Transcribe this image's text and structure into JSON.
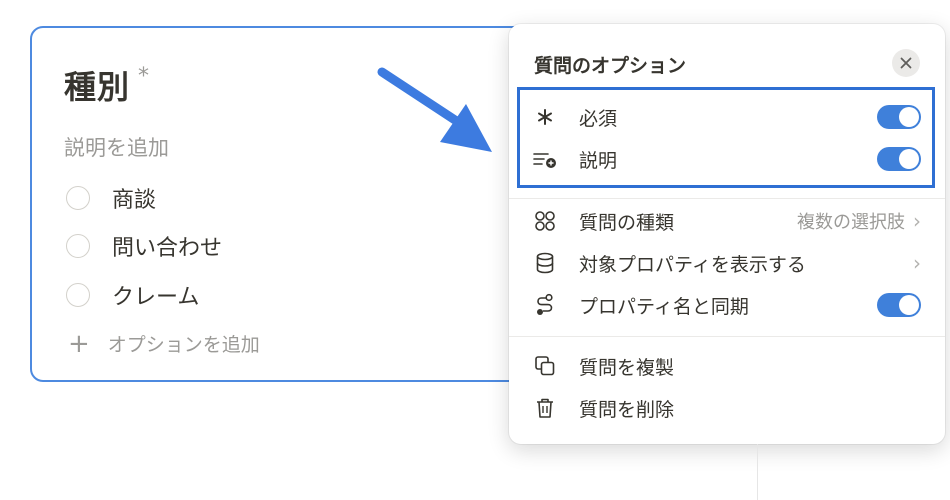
{
  "card": {
    "title": "種別",
    "required_mark": "*",
    "description_placeholder": "説明を追加",
    "options": [
      "商談",
      "問い合わせ",
      "クレーム"
    ],
    "add_option_label": "オプションを追加"
  },
  "menu": {
    "title": "質問のオプション",
    "items": {
      "required": {
        "label": "必須",
        "icon": "asterisk-icon",
        "toggle_on": true
      },
      "description": {
        "label": "説明",
        "icon": "lines-plus-icon",
        "toggle_on": true
      },
      "question_type": {
        "label": "質問の種類",
        "value": "複数の選択肢",
        "icon": "four-circles-icon"
      },
      "show_property": {
        "label": "対象プロパティを表示する",
        "icon": "database-icon"
      },
      "sync_property": {
        "label": "プロパティ名と同期",
        "icon": "sync-path-icon",
        "toggle_on": true
      },
      "duplicate": {
        "label": "質問を複製",
        "icon": "duplicate-icon"
      },
      "delete": {
        "label": "質問を削除",
        "icon": "trash-icon"
      }
    }
  },
  "colors": {
    "accent": "#3f80da",
    "card_border": "#4d8ae0",
    "highlight_border": "#2e6fd3",
    "arrow": "#3d7be0"
  }
}
